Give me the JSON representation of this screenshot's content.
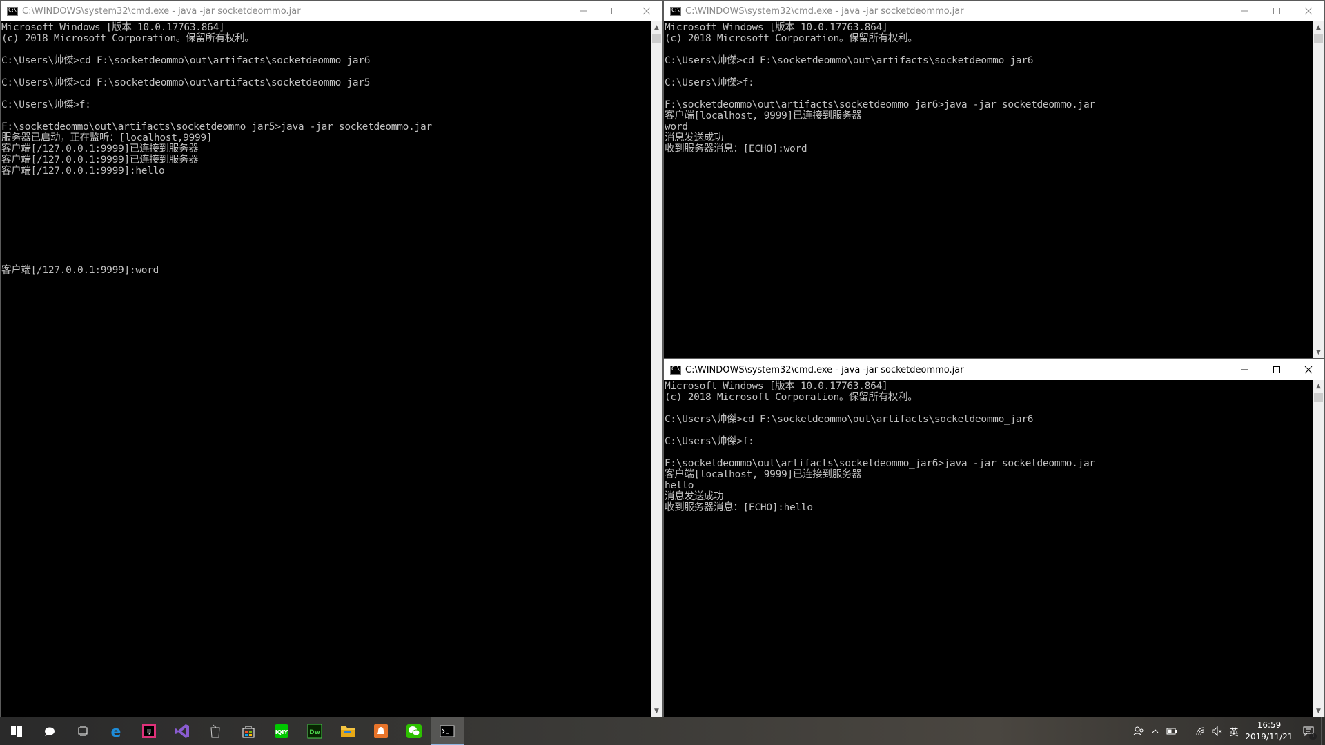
{
  "windows": {
    "left": {
      "title": "C:\\WINDOWS\\system32\\cmd.exe - java  -jar socketdeommo.jar",
      "lines": [
        "Microsoft Windows [版本 10.0.17763.864]",
        "(c) 2018 Microsoft Corporation。保留所有权利。",
        "",
        "C:\\Users\\帅傑>cd F:\\socketdeommo\\out\\artifacts\\socketdeommo_jar6",
        "",
        "C:\\Users\\帅傑>cd F:\\socketdeommo\\out\\artifacts\\socketdeommo_jar5",
        "",
        "C:\\Users\\帅傑>f:",
        "",
        "F:\\socketdeommo\\out\\artifacts\\socketdeommo_jar5>java -jar socketdeommo.jar",
        "服务器已启动，正在监听：[localhost,9999]",
        "客户端[/127.0.0.1:9999]已连接到服务器",
        "客户端[/127.0.0.1:9999]已连接到服务器",
        "客户端[/127.0.0.1:9999]:hello",
        "",
        "",
        "",
        "",
        "",
        "",
        "",
        "",
        "客户端[/127.0.0.1:9999]:word"
      ]
    },
    "top_right": {
      "title": "C:\\WINDOWS\\system32\\cmd.exe - java  -jar socketdeommo.jar",
      "lines": [
        "Microsoft Windows [版本 10.0.17763.864]",
        "(c) 2018 Microsoft Corporation。保留所有权利。",
        "",
        "C:\\Users\\帅傑>cd F:\\socketdeommo\\out\\artifacts\\socketdeommo_jar6",
        "",
        "C:\\Users\\帅傑>f:",
        "",
        "F:\\socketdeommo\\out\\artifacts\\socketdeommo_jar6>java -jar socketdeommo.jar",
        "客户端[localhost, 9999]已连接到服务器",
        "word",
        "消息发送成功",
        "收到服务器消息：[ECHO]:word"
      ]
    },
    "bottom_right": {
      "title": "C:\\WINDOWS\\system32\\cmd.exe - java  -jar socketdeommo.jar",
      "lines": [
        "Microsoft Windows [版本 10.0.17763.864]",
        "(c) 2018 Microsoft Corporation。保留所有权利。",
        "",
        "C:\\Users\\帅傑>cd F:\\socketdeommo\\out\\artifacts\\socketdeommo_jar6",
        "",
        "C:\\Users\\帅傑>f:",
        "",
        "F:\\socketdeommo\\out\\artifacts\\socketdeommo_jar6>java -jar socketdeommo.jar",
        "客户端[localhost, 9999]已连接到服务器",
        "hello",
        "消息发送成功",
        "收到服务器消息：[ECHO]:hello"
      ]
    }
  },
  "taskbar": {
    "icons": [
      {
        "name": "start-icon",
        "color": "#ffffff"
      },
      {
        "name": "cortana-icon",
        "color": "#ffffff"
      },
      {
        "name": "task-view-icon",
        "color": "#ffffff"
      },
      {
        "name": "edge-icon",
        "color": "#1e8cd8"
      },
      {
        "name": "intellij-icon",
        "color": "#e0317a"
      },
      {
        "name": "visual-studio-icon",
        "color": "#8a5cd1"
      },
      {
        "name": "jar-launcher-icon",
        "color": "#d0d0d0"
      },
      {
        "name": "store-icon",
        "color": "#ffffff"
      },
      {
        "name": "iqiyi-icon",
        "color": "#00c800"
      },
      {
        "name": "dreamweaver-icon",
        "color": "#4ad04a"
      },
      {
        "name": "file-explorer-icon",
        "color": "#f5c542"
      },
      {
        "name": "app-orange-icon",
        "color": "#e8742a"
      },
      {
        "name": "wechat-icon",
        "color": "#2dc100"
      },
      {
        "name": "cmd-icon",
        "color": "#cccccc"
      }
    ],
    "tray": {
      "ime": "英",
      "time": "16:59",
      "date": "2019/11/21",
      "notification_count": "1"
    }
  }
}
